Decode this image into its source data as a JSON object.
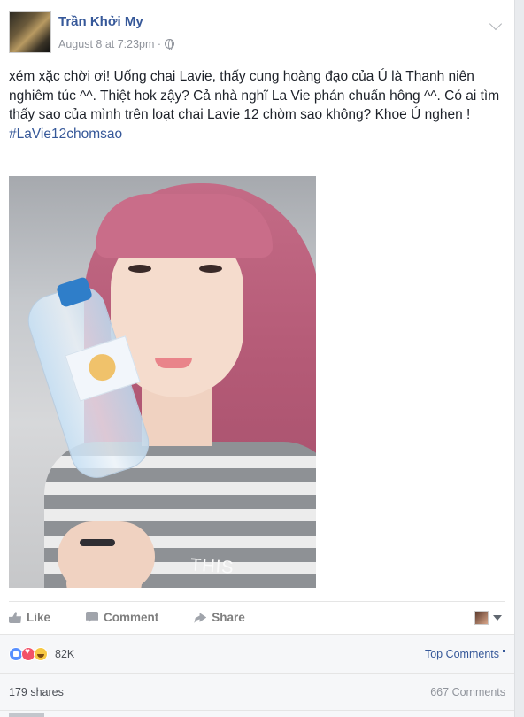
{
  "post": {
    "author": "Trần Khởi My",
    "timestamp": "August 8 at 7:23pm",
    "meta_separator": "·",
    "text": "xém xặc chời ơi! Uống chai Lavie, thấy cung hoàng đạo của Ú là Thanh niên nghiêm túc ^^. Thiệt hok zậy? Cả nhà nghĩ La Vie phán chuẩn hông ^^. Có ai tìm thấy sao của mình trên loạt chai Lavie 12 chòm sao không? Khoe Ú nghen !",
    "hashtag": "#LaVie12chomsao",
    "photo_shirt_text": "THIS"
  },
  "actions": {
    "like": "Like",
    "comment": "Comment",
    "share": "Share"
  },
  "reactions": {
    "types": [
      "like-icon",
      "love-icon",
      "haha-icon"
    ],
    "count": "82K",
    "top_comments": "Top Comments"
  },
  "stats": {
    "shares": "179 shares",
    "comments": "667 Comments"
  },
  "colors": {
    "link_blue": "#365899",
    "like_blue": "#5890ff",
    "love_red": "#f25268",
    "haha_yellow": "#f7c843"
  }
}
